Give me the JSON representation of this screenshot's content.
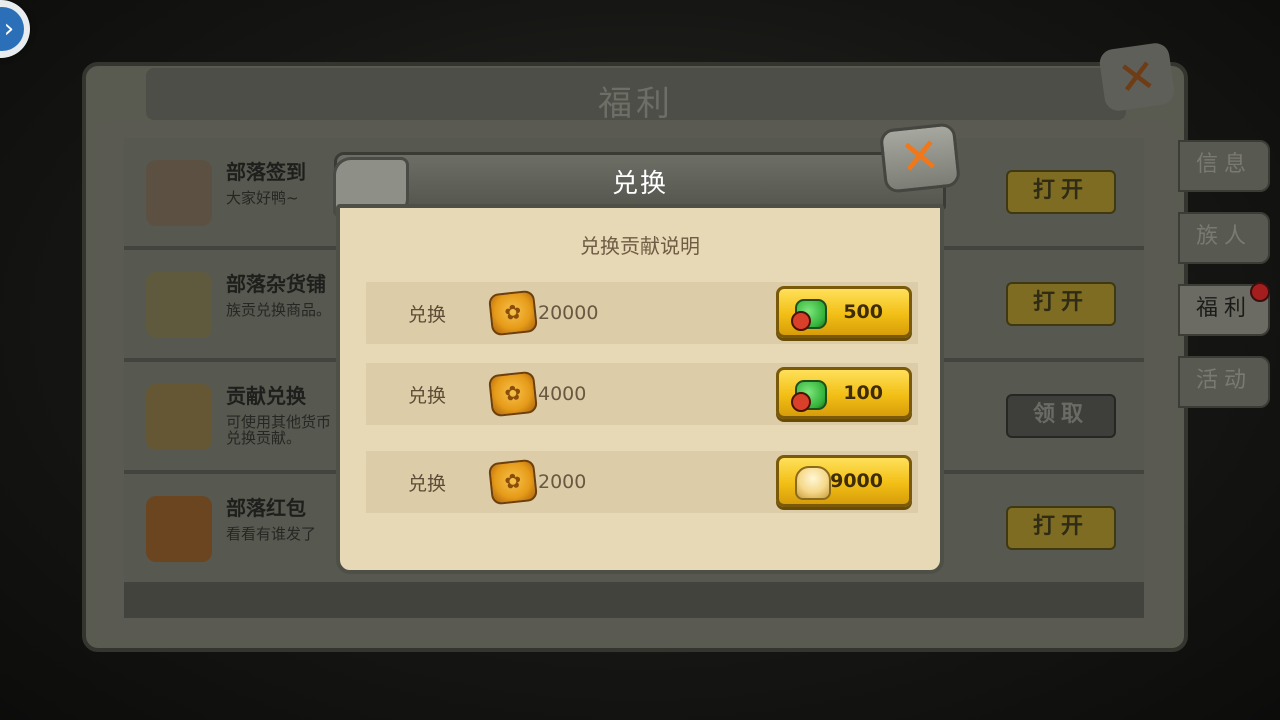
{
  "main": {
    "title": "福利",
    "rows": [
      {
        "title": "部落签到",
        "desc": "大家好鸭~",
        "action": "打开",
        "icon": "tools-icon",
        "style": "gold"
      },
      {
        "title": "部落杂货铺",
        "desc": "族贡兑换商品。",
        "action": "打开",
        "icon": "shop-hut-icon",
        "style": "gold"
      },
      {
        "title": "贡献兑换",
        "desc": "可使用其他货币兑换贡献。",
        "action": "领取",
        "icon": "coin-exchange-icon",
        "style": "grey"
      },
      {
        "title": "部落红包",
        "desc": "看看有谁发了",
        "action": "打开",
        "icon": "red-envelope-icon",
        "style": "gold"
      }
    ]
  },
  "tabs": [
    "信息",
    "族人",
    "福利",
    "活动"
  ],
  "modal": {
    "title": "兑换",
    "subtitle": "兑换贡献说明",
    "items": [
      {
        "label": "兑换",
        "cost": "20000",
        "reward": "500",
        "reward_icon": "green-gem-icon"
      },
      {
        "label": "兑换",
        "cost": "4000",
        "reward": "100",
        "reward_icon": "green-gem-icon"
      },
      {
        "label": "兑换",
        "cost": "2000",
        "reward": "9000",
        "reward_icon": "shell-icon"
      }
    ]
  },
  "colors": {
    "modal_bg": "#e8d9b6",
    "button_gold": "#f2bf15",
    "close_orange": "#f0781a"
  }
}
